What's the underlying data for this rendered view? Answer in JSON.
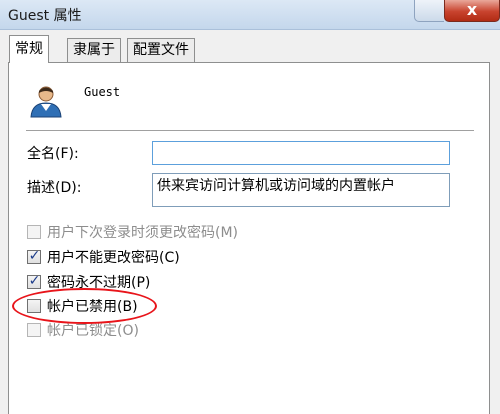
{
  "window": {
    "title": "Guest 属性",
    "close_label": "x"
  },
  "tabs": [
    {
      "label": "常规"
    },
    {
      "label": "隶属于"
    },
    {
      "label": "配置文件"
    }
  ],
  "user": {
    "name": "Guest"
  },
  "fields": {
    "fullname_label": "全名(F):",
    "fullname_value": "",
    "description_label": "描述(D):",
    "description_value": "供来宾访问计算机或访问域的内置帐户"
  },
  "checkboxes": [
    {
      "label": "用户下次登录时须更改密码(M)",
      "checked": false,
      "disabled": true
    },
    {
      "label": "用户不能更改密码(C)",
      "checked": true,
      "disabled": false
    },
    {
      "label": "密码永不过期(P)",
      "checked": true,
      "disabled": false
    },
    {
      "label": "帐户已禁用(B)",
      "checked": false,
      "disabled": false
    },
    {
      "label": "帐户已锁定(O)",
      "checked": false,
      "disabled": true
    }
  ],
  "colors": {
    "highlight": "#e8141a",
    "close_button": "#c8432e"
  },
  "icons": {
    "user_avatar": "user-icon",
    "check": "checkmark-icon"
  }
}
